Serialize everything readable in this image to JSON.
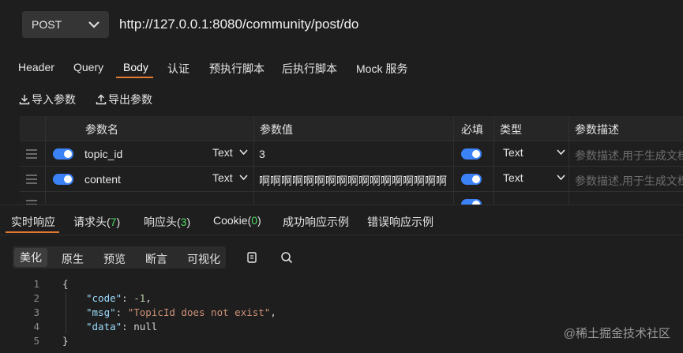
{
  "request": {
    "method": "POST",
    "url": "http://127.0.0.1:8080/community/post/do"
  },
  "tabs": [
    "Header",
    "Query",
    "Body",
    "认证",
    "预执行脚本",
    "后执行脚本",
    "Mock 服务"
  ],
  "active_tab": "Body",
  "actions": {
    "import": "导入参数",
    "export": "导出参数"
  },
  "params_table": {
    "headers": {
      "name": "参数名",
      "value": "参数值",
      "required": "必填",
      "type": "类型",
      "desc": "参数描述"
    },
    "rows": [
      {
        "name": "topic_id",
        "value_type": "Text",
        "value": "3",
        "required": true,
        "type": "Text",
        "desc_placeholder": "参数描述,用于生成文档"
      },
      {
        "name": "content",
        "value_type": "Text",
        "value": "啊啊啊啊啊啊啊啊啊啊啊啊啊啊啊啊啊",
        "required": true,
        "type": "Text",
        "desc_placeholder": "参数描述,用于生成文档"
      }
    ]
  },
  "response_tabs": {
    "realtime": "实时响应",
    "req_headers": "请求头(",
    "req_headers_count": "7",
    "resp_headers": "响应头(",
    "resp_headers_count": "3",
    "cookie": "Cookie(",
    "cookie_count": "0",
    "close_paren": ")",
    "success_example": "成功响应示例",
    "error_example": "错误响应示例"
  },
  "view_modes": [
    "美化",
    "原生",
    "预览",
    "断言",
    "可视化"
  ],
  "active_view": "美化",
  "icons": [
    "copy-icon",
    "search-icon"
  ],
  "code": {
    "line_numbers": [
      "1",
      "2",
      "3",
      "4",
      "5"
    ],
    "open_brace": "{",
    "close_brace": "}",
    "code_key": "\"code\"",
    "code_val": "-1",
    "msg_key": "\"msg\"",
    "msg_val": "\"TopicId does not exist\"",
    "data_key": "\"data\"",
    "data_val": "null",
    "colon": ": ",
    "comma": ","
  },
  "watermark": "@稀土掘金技术社区",
  "colors": {
    "accent": "#e07a2f",
    "toggle": "#3b82f6",
    "count": "#4cd964"
  }
}
